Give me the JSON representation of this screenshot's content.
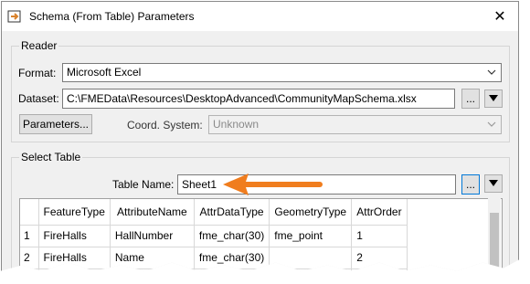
{
  "window": {
    "title": "Schema (From Table) Parameters",
    "close_glyph": "✕"
  },
  "reader": {
    "group_label": "Reader",
    "format_label": "Format:",
    "format_value": "Microsoft Excel",
    "dataset_label": "Dataset:",
    "dataset_value": "C:\\FMEData\\Resources\\DesktopAdvanced\\CommunityMapSchema.xlsx",
    "browse_label": "...",
    "parameters_label": "Parameters...",
    "coord_label": "Coord. System:",
    "coord_value": "Unknown"
  },
  "select_table": {
    "group_label": "Select Table",
    "table_name_label": "Table Name:",
    "table_name_value": "Sheet1",
    "browse_label": "...",
    "columns": [
      "",
      "FeatureType",
      "AttributeName",
      "AttrDataType",
      "GeometryType",
      "AttrOrder"
    ],
    "rows": [
      [
        "1",
        "FireHalls",
        "HallNumber",
        "fme_char(30)",
        "fme_point",
        "1"
      ],
      [
        "2",
        "FireHalls",
        "Name",
        "fme_char(30)",
        "",
        "2"
      ],
      [
        "",
        "",
        "",
        "",
        "",
        ""
      ]
    ]
  },
  "annotation": {
    "arrow_color": "#f07d1e"
  }
}
